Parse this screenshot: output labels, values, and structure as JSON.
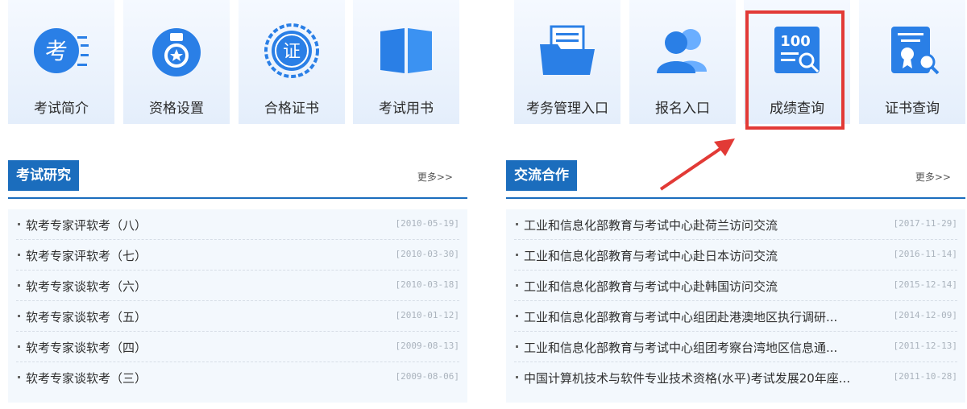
{
  "tiles": [
    {
      "label": "考试简介",
      "icon": "exam-intro-icon"
    },
    {
      "label": "资格设置",
      "icon": "medal-icon"
    },
    {
      "label": "合格证书",
      "icon": "certificate-seal-icon"
    },
    {
      "label": "考试用书",
      "icon": "book-icon"
    },
    {
      "label": "考务管理入口",
      "icon": "folder-icon"
    },
    {
      "label": "报名入口",
      "icon": "users-icon"
    },
    {
      "label": "成绩查询",
      "icon": "score-search-icon"
    },
    {
      "label": "证书查询",
      "icon": "certificate-search-icon"
    }
  ],
  "research": {
    "title": "考试研究",
    "more": "更多>>",
    "items": [
      {
        "title": "软考专家评软考（八）",
        "date": "[2010-05-19]"
      },
      {
        "title": "软考专家评软考（七）",
        "date": "[2010-03-30]"
      },
      {
        "title": "软考专家谈软考（六）",
        "date": "[2010-03-18]"
      },
      {
        "title": "软考专家谈软考（五）",
        "date": "[2010-01-12]"
      },
      {
        "title": "软考专家谈软考（四）",
        "date": "[2009-08-13]"
      },
      {
        "title": "软考专家谈软考（三）",
        "date": "[2009-08-06]"
      }
    ]
  },
  "cooperation": {
    "title": "交流合作",
    "more": "更多>>",
    "items": [
      {
        "title": "工业和信息化部教育与考试中心赴荷兰访问交流",
        "date": "[2017-11-29]"
      },
      {
        "title": "工业和信息化部教育与考试中心赴日本访问交流",
        "date": "[2016-11-14]"
      },
      {
        "title": "工业和信息化部教育与考试中心赴韩国访问交流",
        "date": "[2015-12-14]"
      },
      {
        "title": "工业和信息化部教育与考试中心组团赴港澳地区执行调研...",
        "date": "[2014-12-09]"
      },
      {
        "title": "工业和信息化部教育与考试中心组团考察台湾地区信息通...",
        "date": "[2011-12-13]"
      },
      {
        "title": "中国计算机技术与软件专业技术资格(水平)考试发展20年座...",
        "date": "[2011-10-28]"
      }
    ]
  },
  "colors": {
    "accent": "#1b6dbd",
    "highlight": "#e23a36",
    "icon": "#2a7fe6"
  }
}
